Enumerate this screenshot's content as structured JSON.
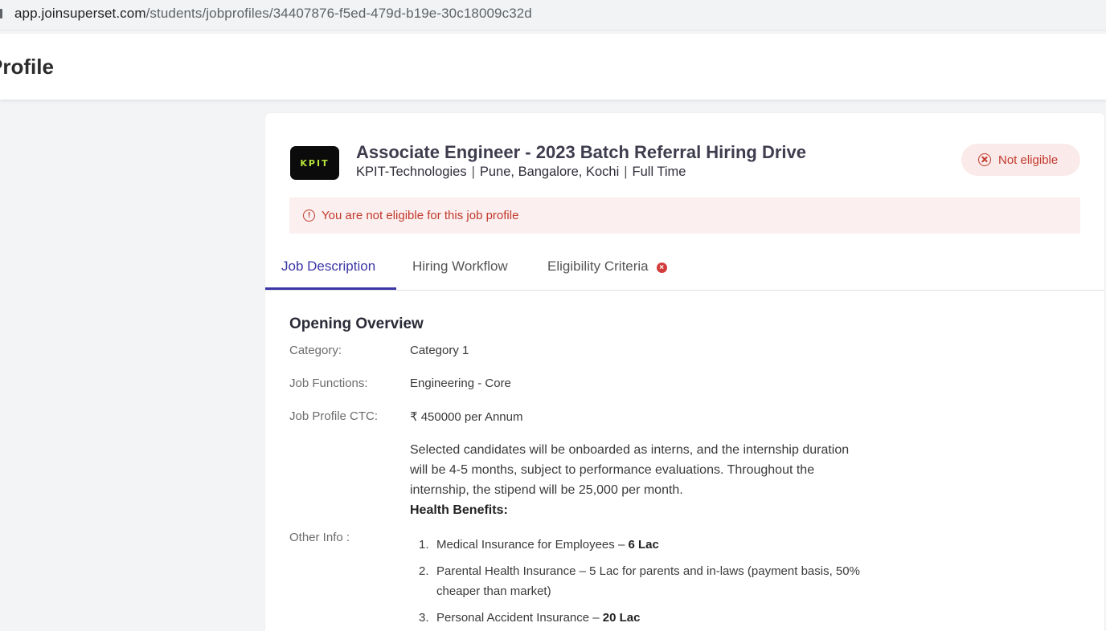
{
  "browser": {
    "url_domain": "app.joinsuperset.com",
    "url_path": "/students/jobprofiles/34407876-f5ed-479d-b19e-30c18009c32d"
  },
  "header": {
    "page_title": "Profile"
  },
  "job": {
    "logo_text": "KPIT",
    "title": "Associate Engineer - 2023 Batch Referral Hiring Drive",
    "company": "KPIT-Technologies",
    "locations": "Pune, Bangalore, Kochi",
    "job_type": "Full Time",
    "separator": "|",
    "eligibility_badge": "Not eligible",
    "alert_text": "You are not eligible for this job profile"
  },
  "tabs": [
    {
      "label": "Job Description",
      "active": true
    },
    {
      "label": "Hiring Workflow",
      "active": false
    },
    {
      "label": "Eligibility Criteria",
      "active": false
    }
  ],
  "overview": {
    "section_title": "Opening Overview",
    "category_label": "Category:",
    "category_value": "Category 1",
    "functions_label": "Job Functions:",
    "functions_value": "Engineering - Core",
    "ctc_label": "Job Profile CTC:",
    "ctc_value": "₹ 450000 per Annum",
    "other_info_label": "Other Info :",
    "other_info_text": "Selected candidates will be onboarded as interns, and the internship duration will be 4-5 months, subject to performance evaluations. Throughout the internship, the stipend will be 25,000 per month.",
    "health_heading": "Health Benefits:",
    "benefits": [
      {
        "num": "1.",
        "text": "Medical Insurance for Employees – ",
        "bold": "6 Lac"
      },
      {
        "num": "2.",
        "text": "Parental Health Insurance – 5 Lac for parents and in-laws (payment basis, 50% cheaper than market)",
        "bold": ""
      },
      {
        "num": "3.",
        "text": "Personal Accident Insurance – ",
        "bold": "20 Lac"
      }
    ]
  },
  "colors": {
    "accent": "#3b36a6",
    "error": "#c0392b",
    "error_bg": "#fbeff0",
    "page_bg": "#f3f4f6"
  },
  "icons": {
    "lock": "lock-icon",
    "badge": "x-circle-icon",
    "alert": "alert-circle-icon",
    "tab_status": "x-circle-filled-icon"
  }
}
